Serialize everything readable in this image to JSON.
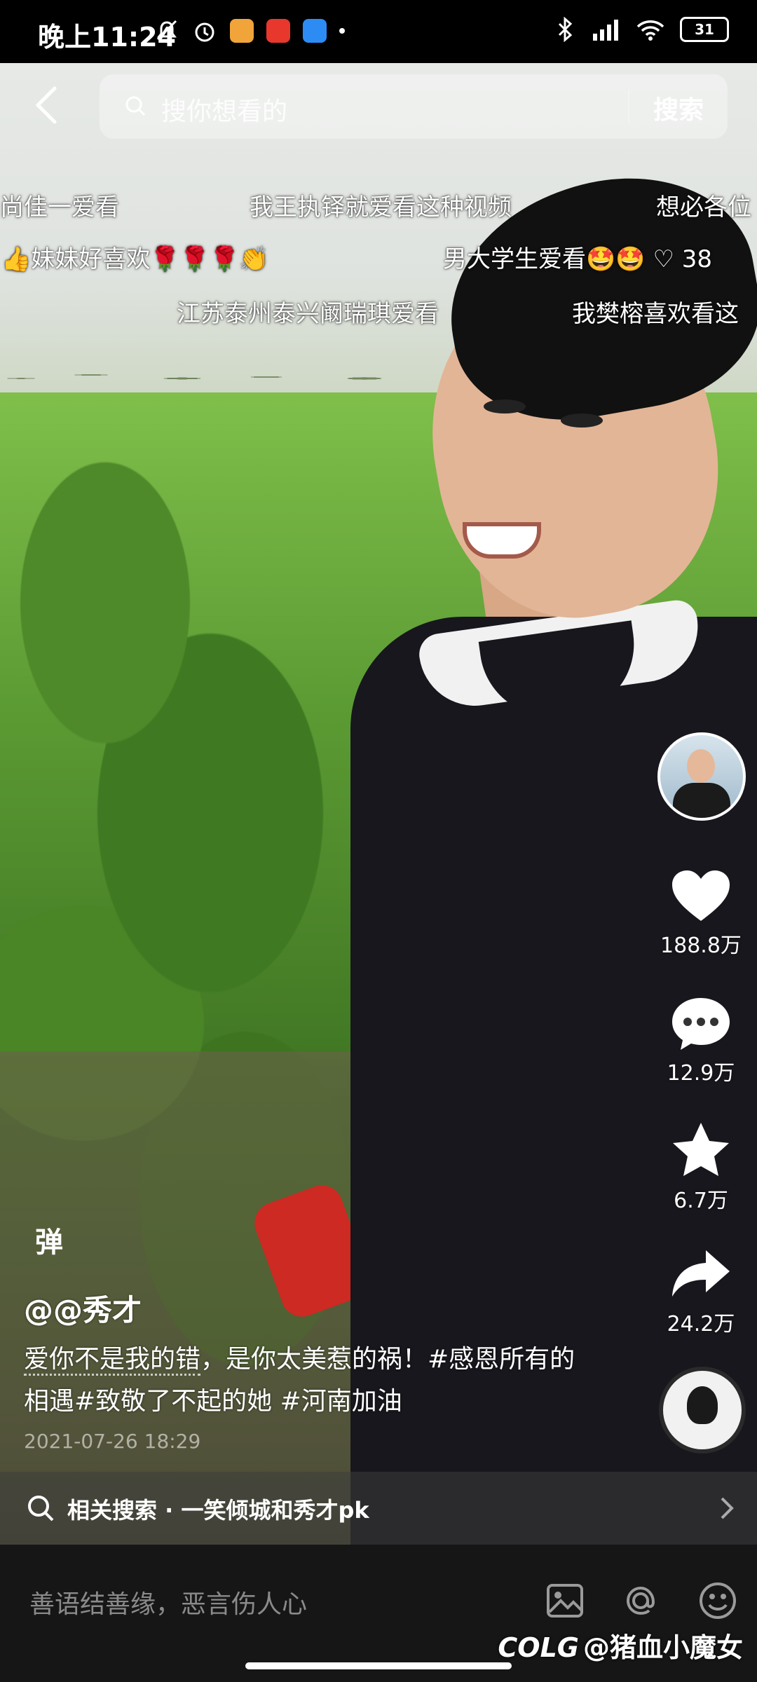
{
  "status_bar": {
    "time": "晚上11:24",
    "battery": "31"
  },
  "search": {
    "placeholder": "搜你想看的",
    "button": "搜索"
  },
  "danmaku": [
    "尚佳一爱看",
    "我王执铎就爱看这种视频",
    "想必各位",
    "👍妹妹好喜欢🌹🌹🌹👏",
    "男大学生爱看🤩🤩 ♡ 38",
    "江苏泰州泰兴阚瑞琪爱看",
    "我樊榕喜欢看这"
  ],
  "actions": {
    "likes": "188.8万",
    "comments": "12.9万",
    "favorites": "6.7万",
    "shares": "24.2万"
  },
  "video": {
    "danmu_toggle": "弹",
    "author": "@@秀才",
    "description_part1": "爱你不是我的错",
    "description_part2": "，是你太美惹的祸！#感恩所有的相遇#致敬了不起的她 #河南加油",
    "date": "2021-07-26 18:29"
  },
  "related": {
    "text": "相关搜索 · 一笑倾城和秀才pk"
  },
  "comment_bar": {
    "placeholder": "善语结善缘，恶言伤人心"
  },
  "watermark": "@猪血小魔女",
  "watermark_logo": "COLG"
}
